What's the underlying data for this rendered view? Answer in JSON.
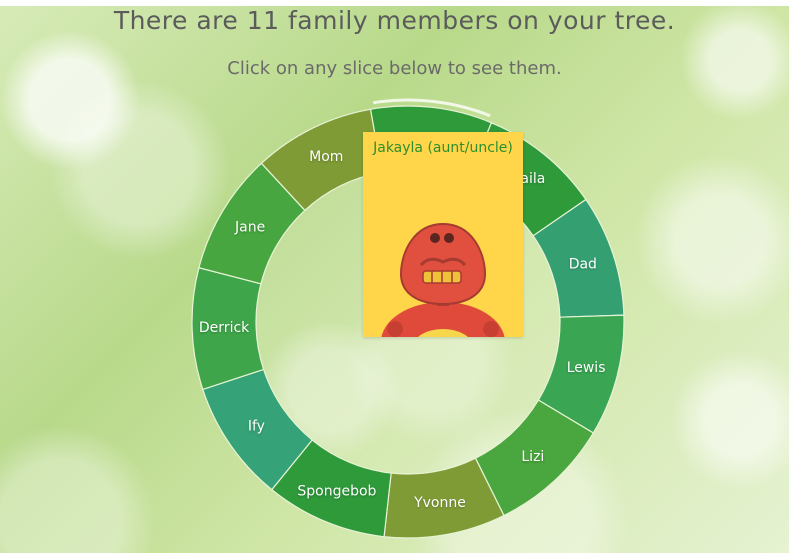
{
  "header": {
    "title": "There are 11 family members on your tree.",
    "subtitle": "Click on any slice below to see them."
  },
  "wheel": {
    "members": [
      {
        "label": "Jakayla",
        "color": "#2e9a3a"
      },
      {
        "label": "Shaila",
        "color": "#2e9a3a"
      },
      {
        "label": "Dad",
        "color": "#34a072"
      },
      {
        "label": "Lewis",
        "color": "#3aa654"
      },
      {
        "label": "Lizi",
        "color": "#4aa63e"
      },
      {
        "label": "Yvonne",
        "color": "#7f9b36"
      },
      {
        "label": "Spongebob",
        "color": "#2e9a3a"
      },
      {
        "label": "Ify",
        "color": "#35a277"
      },
      {
        "label": "Derrick",
        "color": "#3fa54a"
      },
      {
        "label": "Jane",
        "color": "#47a63f"
      },
      {
        "label": "Mom",
        "color": "#7f9b36"
      }
    ],
    "selected_label": "Jakayla"
  },
  "popup": {
    "title": "Jakayla (aunt/uncle)",
    "image_icon": "robot-avatar-icon"
  }
}
